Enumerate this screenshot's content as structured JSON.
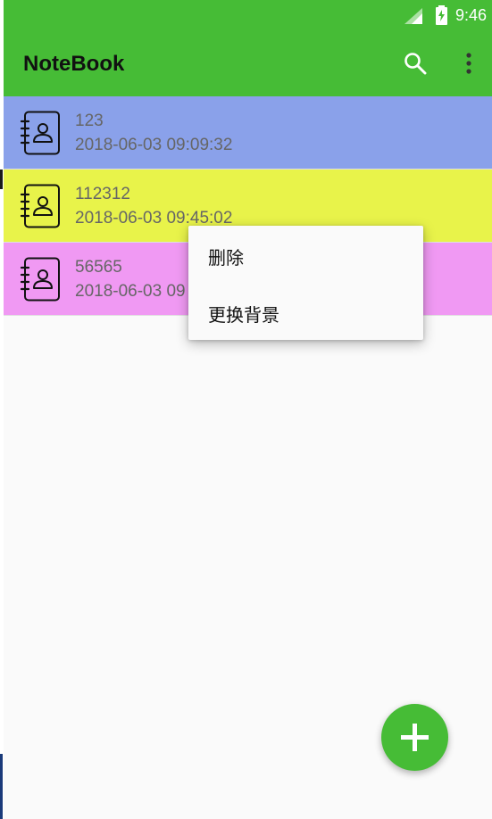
{
  "status_bar": {
    "time": "9:46",
    "signal_icon": "signal-icon",
    "battery_icon": "battery-charging-icon"
  },
  "app_bar": {
    "title": "NoteBook",
    "search_icon": "search-icon",
    "more_icon": "more-vert-icon",
    "color": "#46bc36"
  },
  "notes": [
    {
      "title": "123",
      "time": "2018-06-03 09:09:32",
      "color": "#8aa1ea"
    },
    {
      "title": "112312",
      "time": "2018-06-03 09:45:02",
      "color": "#e8f34a"
    },
    {
      "title": "56565",
      "time": "2018-06-03 09",
      "color": "#f099f3"
    }
  ],
  "context_menu": {
    "items": [
      {
        "label": "删除"
      },
      {
        "label": "更换背景"
      }
    ]
  },
  "fab": {
    "icon": "add-icon",
    "color": "#46bc36"
  }
}
